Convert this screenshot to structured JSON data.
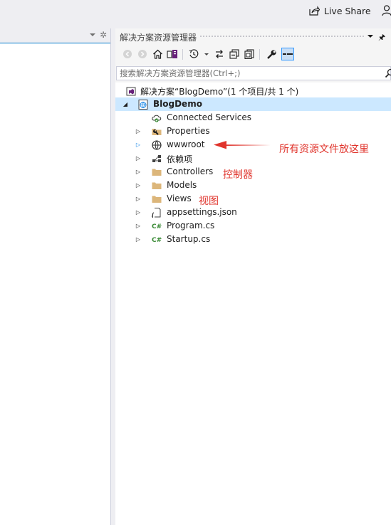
{
  "topbar": {
    "live_share_label": "Live Share"
  },
  "solution_explorer": {
    "title": "解决方案资源管理器",
    "search": {
      "placeholder": "搜索解决方案资源管理器(Ctrl+;)",
      "value": ""
    },
    "toolbar_icons": [
      "back-icon",
      "forward-icon",
      "home-icon",
      "switch-views-icon",
      "pending-changes-filter-icon",
      "sync-icon",
      "collapse-all-icon",
      "show-all-files-icon",
      "properties-icon",
      "preview-icon"
    ],
    "tree": [
      {
        "id": "solution",
        "label": "解决方案“BlogDemo”(1 个项目/共 1 个)",
        "icon": "solution-icon",
        "arrow": "",
        "bold": false,
        "selected": false
      },
      {
        "id": "project",
        "label": "BlogDemo",
        "icon": "web-project-icon",
        "arrow": "expanded",
        "bold": true,
        "selected": true
      },
      {
        "id": "connected",
        "label": "Connected Services",
        "icon": "connected-services-icon",
        "arrow": "",
        "bold": false,
        "selected": false
      },
      {
        "id": "properties",
        "label": "Properties",
        "icon": "properties-folder-icon",
        "arrow": "collapsed",
        "bold": false,
        "selected": false
      },
      {
        "id": "wwwroot",
        "label": "wwwroot",
        "icon": "globe-icon",
        "arrow": "collapsed-blue",
        "bold": false,
        "selected": false
      },
      {
        "id": "deps",
        "label": "依赖项",
        "icon": "dependencies-icon",
        "arrow": "collapsed",
        "bold": false,
        "selected": false
      },
      {
        "id": "controllers",
        "label": "Controllers",
        "icon": "folder-icon",
        "arrow": "collapsed",
        "bold": false,
        "selected": false
      },
      {
        "id": "models",
        "label": "Models",
        "icon": "folder-icon",
        "arrow": "collapsed",
        "bold": false,
        "selected": false
      },
      {
        "id": "views",
        "label": "Views",
        "icon": "folder-icon",
        "arrow": "collapsed",
        "bold": false,
        "selected": false
      },
      {
        "id": "appsettings",
        "label": "appsettings.json",
        "icon": "json-file-icon",
        "arrow": "collapsed",
        "bold": false,
        "selected": false
      },
      {
        "id": "program",
        "label": "Program.cs",
        "icon": "csharp-file-icon",
        "arrow": "collapsed",
        "bold": false,
        "selected": false
      },
      {
        "id": "startup",
        "label": "Startup.cs",
        "icon": "csharp-file-icon",
        "arrow": "collapsed",
        "bold": false,
        "selected": false
      }
    ]
  },
  "annotations": {
    "wwwroot": "所有资源文件放这里",
    "controllers": "控制器",
    "views": "视图"
  },
  "colors": {
    "accent": "#007acc",
    "selection": "#cce8ff",
    "annotation": "#e0342c",
    "folder": "#dcb67a",
    "csharp": "#388a34"
  }
}
